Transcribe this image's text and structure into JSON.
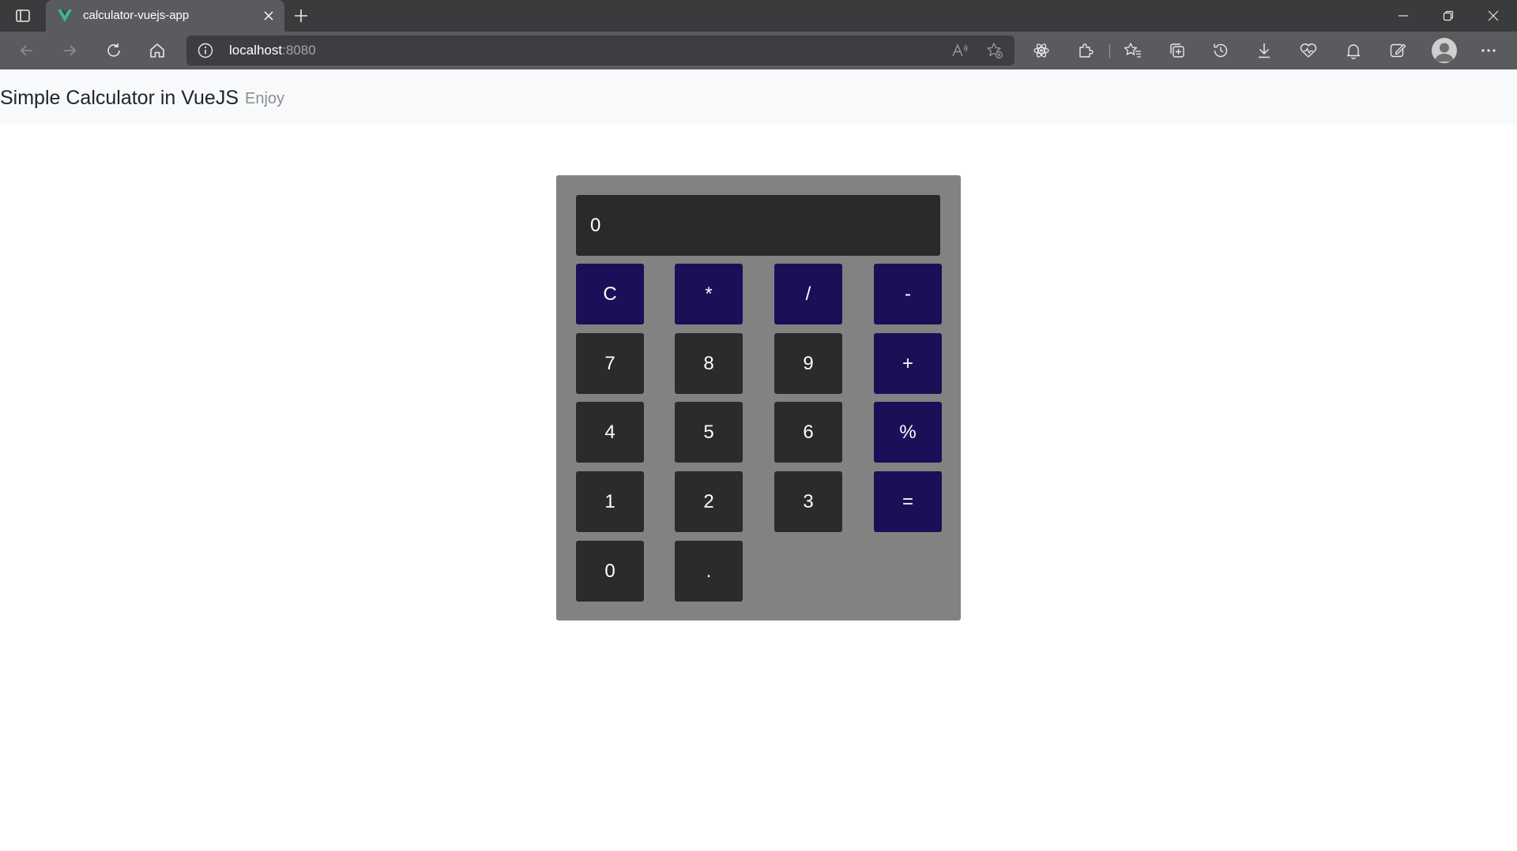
{
  "browser": {
    "tab": {
      "title": "calculator-vuejs-app"
    },
    "address": {
      "host": "localhost",
      "port": ":8080"
    }
  },
  "page": {
    "brand": "Simple Calculator in VueJS",
    "nav_link": "Enjoy"
  },
  "calculator": {
    "display": "0",
    "keys": {
      "clear": "C",
      "multiply": "*",
      "divide": "/",
      "subtract": "-",
      "seven": "7",
      "eight": "8",
      "nine": "9",
      "add": "+",
      "four": "4",
      "five": "5",
      "six": "6",
      "percent": "%",
      "one": "1",
      "two": "2",
      "three": "3",
      "equals": "=",
      "zero": "0",
      "dot": "."
    }
  },
  "colors": {
    "operator_key": "#1b0f57",
    "number_key": "#2b2b2b",
    "calculator_body": "#828282",
    "favicon_vue": "#41b883"
  }
}
